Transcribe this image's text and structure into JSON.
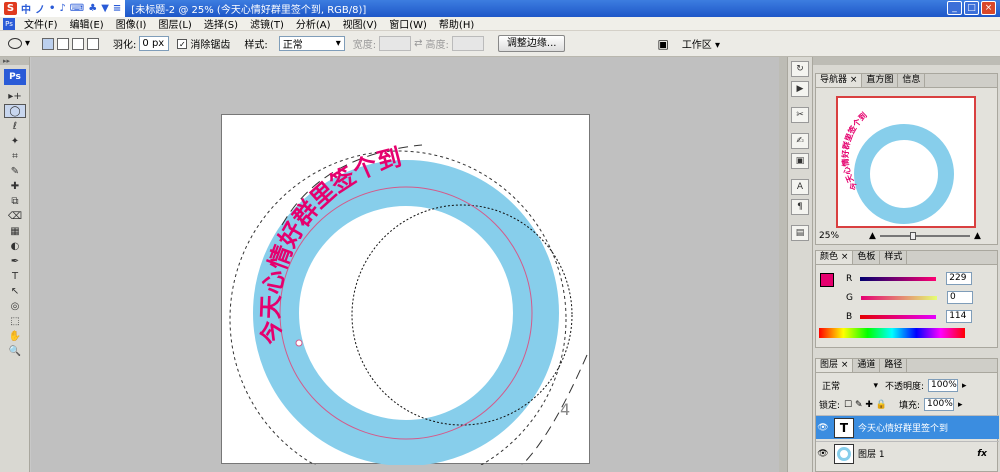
{
  "titlebar": {
    "ime_logo": "S",
    "ime_items": [
      "中",
      "ノ",
      "•",
      "♪",
      "⌨",
      "♣",
      "▼",
      "≡"
    ],
    "title": "[未标题-2 @ 25% (今天心情好群里签个到, RGB/8)]",
    "min": "_",
    "max": "□",
    "close": "×"
  },
  "menu": {
    "ps_icon": "Ps",
    "items": [
      "文件(F)",
      "编辑(E)",
      "图像(I)",
      "图层(L)",
      "选择(S)",
      "滤镜(T)",
      "分析(A)",
      "视图(V)",
      "窗口(W)",
      "帮助(H)"
    ]
  },
  "options": {
    "feather_label": "羽化:",
    "feather_value": "0 px",
    "antialias_label": "消除锯齿",
    "antialias_checked": "✓",
    "style_label": "样式:",
    "style_value": "正常",
    "width_label": "宽度:",
    "height_label": "高度:",
    "swap_icon": "⇄",
    "refine_button": "调整边缘...",
    "workspace_label": "工作区 ▾"
  },
  "toolbox": {
    "logo": "Ps",
    "tools": [
      "▸+",
      "◯",
      "ℓ",
      "✦",
      "⌗",
      "✎",
      "✚",
      "⧉",
      "⌫",
      "▦",
      "◐",
      "✒",
      "T",
      "↖",
      "◎",
      "⬚",
      "✋",
      "🔍"
    ]
  },
  "canvas": {
    "text_on_path": "今天心情好群里签个到",
    "corner_mark": "4",
    "ring_color": "#87ceeb",
    "text_color": "#e5006e"
  },
  "iconcol": {
    "icons": [
      "↻",
      "▶",
      "✂",
      "✍",
      "▣",
      "A",
      "¶",
      "▤"
    ]
  },
  "navigator": {
    "tabs": [
      "导航器 ×",
      "直方图",
      "信息"
    ],
    "zoom": "25%",
    "thumb_text": "今天心情好群里签个到"
  },
  "color": {
    "tabs": [
      "颜色 ×",
      "色板",
      "样式"
    ],
    "fg_color": "#e5006e",
    "r_label": "R",
    "g_label": "G",
    "b_label": "B",
    "r_value": "229",
    "g_value": "0",
    "b_value": "114"
  },
  "layers": {
    "tabs": [
      "图层 ×",
      "通道",
      "路径"
    ],
    "blend_mode": "正常",
    "opacity_label": "不透明度:",
    "opacity_value": "100%",
    "lock_label": "锁定:",
    "lock_icons": "☐ ✎ ✚ 🔒",
    "fill_label": "填充:",
    "fill_value": "100%",
    "layer1_thumb": "T",
    "layer1_name": "今天心情好群里签个到",
    "layer2_name": "图层 1",
    "fx_label": "fx",
    "eye": "👁"
  }
}
